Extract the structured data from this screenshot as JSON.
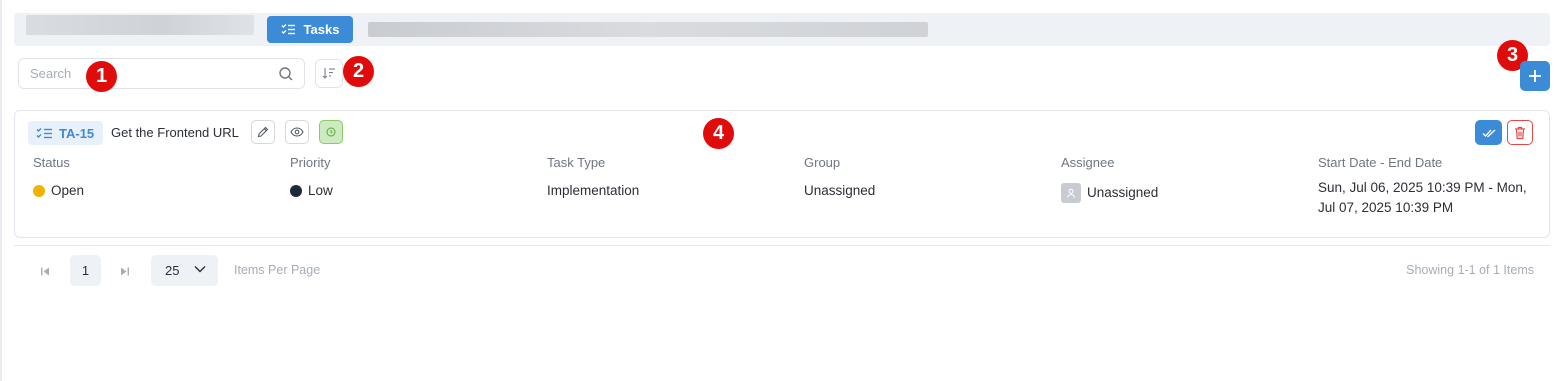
{
  "header": {
    "tab_label": "Tasks"
  },
  "toolbar": {
    "search_placeholder": "Search"
  },
  "annotations": [
    "1",
    "2",
    "3",
    "4"
  ],
  "task": {
    "id": "TA-15",
    "title": "Get the Frontend URL",
    "columns": [
      {
        "header": "Status",
        "value": "Open",
        "dot_color": "#f0b400"
      },
      {
        "header": "Priority",
        "value": "Low",
        "dot_color": "#1f2937"
      },
      {
        "header": "Task Type",
        "value": "Implementation"
      },
      {
        "header": "Group",
        "value": "Unassigned"
      },
      {
        "header": "Assignee",
        "value": "Unassigned"
      },
      {
        "header": "Start Date - End Date",
        "value": "Sun, Jul 06, 2025 10:39 PM - Mon, Jul 07, 2025 10:39 PM"
      }
    ]
  },
  "pagination": {
    "current_page": "1",
    "page_size": "25",
    "items_per_page_label": "Items Per Page",
    "showing": "Showing 1-1 of 1 Items"
  },
  "colors": {
    "accent": "#3b8bd6",
    "danger": "#e34848",
    "badge": "#e00b0b"
  },
  "icons": [
    "tasks-icon",
    "search-icon",
    "sort-icon",
    "plus-icon",
    "edit-icon",
    "eye-icon",
    "timer-icon",
    "double-check-icon",
    "trash-icon",
    "user-icon",
    "first-page-icon",
    "last-page-icon",
    "chevron-down-icon"
  ]
}
